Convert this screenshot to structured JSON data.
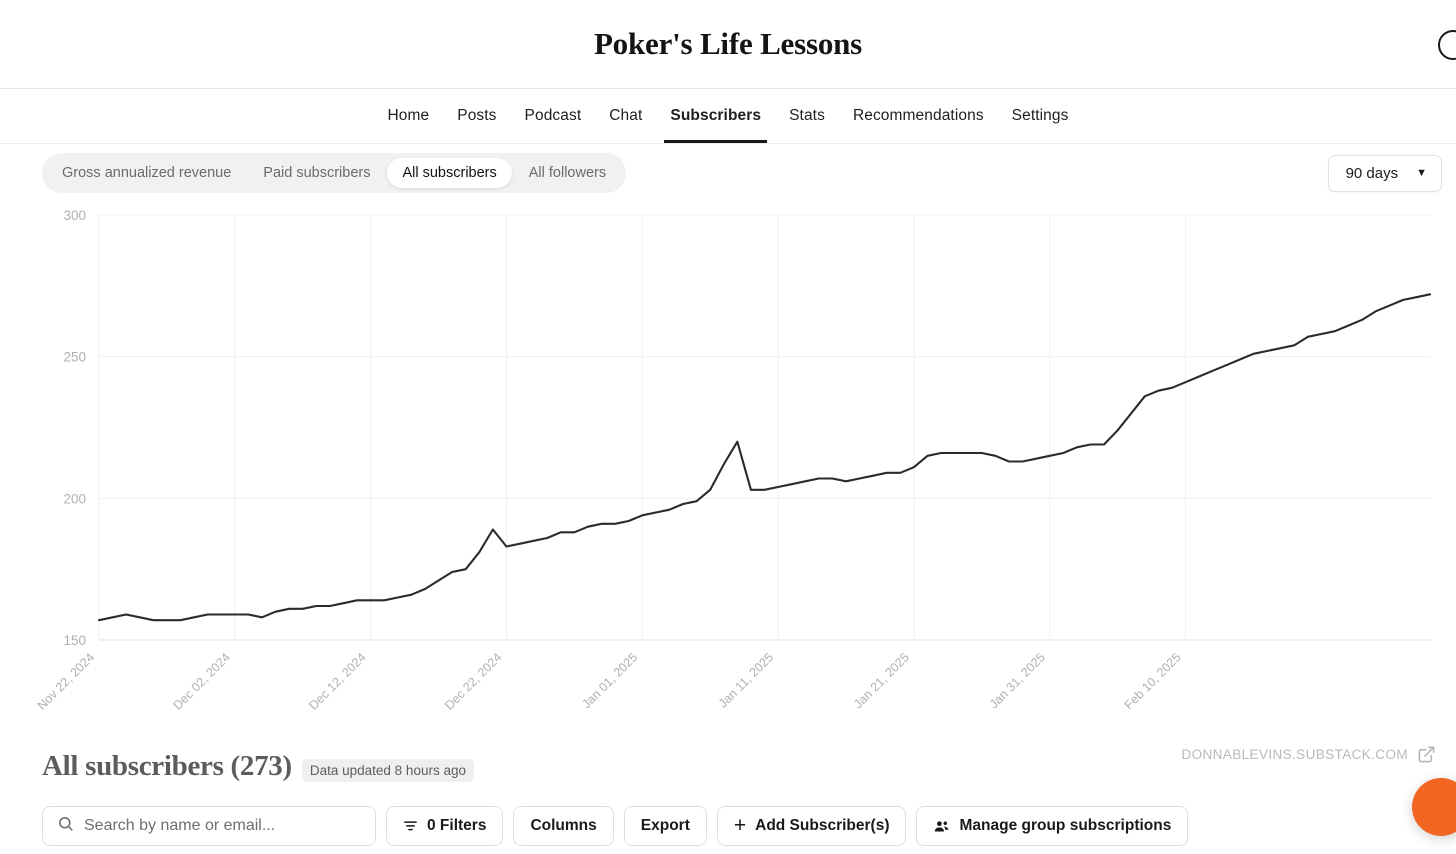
{
  "header": {
    "publication_title": "Poker's Life Lessons",
    "avatar_icon": "profile-circle-icon"
  },
  "nav": {
    "items": [
      {
        "label": "Home",
        "active": false
      },
      {
        "label": "Posts",
        "active": false
      },
      {
        "label": "Podcast",
        "active": false
      },
      {
        "label": "Chat",
        "active": false
      },
      {
        "label": "Subscribers",
        "active": true
      },
      {
        "label": "Stats",
        "active": false
      },
      {
        "label": "Recommendations",
        "active": false
      },
      {
        "label": "Settings",
        "active": false
      }
    ]
  },
  "chart_controls": {
    "pills": [
      {
        "label": "Gross annualized revenue",
        "active": false
      },
      {
        "label": "Paid subscribers",
        "active": false
      },
      {
        "label": "All subscribers",
        "active": true
      },
      {
        "label": "All followers",
        "active": false
      }
    ],
    "range": {
      "label": "90 days",
      "caret_icon": "chevron-down-icon"
    }
  },
  "watermark": {
    "text": "DONNABLEVINS.SUBSTACK.COM",
    "icon": "external-link-icon"
  },
  "list": {
    "title": "All subscribers (273)",
    "data_updated": "Data updated 8 hours ago",
    "search_placeholder": "Search by name or email...",
    "search_value": "",
    "search_icon": "search-icon",
    "buttons": [
      {
        "label": "0 Filters",
        "icon": "filter-funnel-icon"
      },
      {
        "label": "Columns",
        "icon": null
      },
      {
        "label": "Export",
        "icon": null
      },
      {
        "label": "Add Subscriber(s)",
        "icon": "plus-icon"
      },
      {
        "label": "Manage group subscriptions",
        "icon": "people-icon"
      }
    ]
  },
  "fab": {
    "icon": "chat-bubble-icon",
    "color": "#f26522"
  },
  "colors": {
    "line": "#2b2b2b",
    "grid": "#f0f0f0",
    "axis_text": "#b0b0b0",
    "accent": "#f26522"
  },
  "chart_data": {
    "type": "line",
    "title": "",
    "xlabel": "",
    "ylabel": "",
    "ylim": [
      150,
      300
    ],
    "yticks": [
      150,
      200,
      250,
      300
    ],
    "grid": true,
    "legend": null,
    "xticks": [
      "Nov 22, 2024",
      "Dec 02, 2024",
      "Dec 12, 2024",
      "Dec 22, 2024",
      "Jan 01, 2025",
      "Jan 11, 2025",
      "Jan 21, 2025",
      "Jan 31, 2025",
      "Feb 10, 2025"
    ],
    "x_start": "Nov 22, 2024",
    "x_end": "Feb 17, 2025",
    "series": [
      {
        "name": "All subscribers",
        "color": "#2b2b2b",
        "values": [
          157,
          158,
          159,
          158,
          157,
          157,
          157,
          158,
          159,
          159,
          159,
          159,
          158,
          160,
          161,
          161,
          162,
          162,
          163,
          164,
          164,
          164,
          165,
          166,
          168,
          171,
          174,
          175,
          181,
          189,
          183,
          184,
          185,
          186,
          188,
          188,
          190,
          191,
          191,
          192,
          194,
          195,
          196,
          198,
          199,
          203,
          212,
          220,
          203,
          203,
          204,
          205,
          206,
          207,
          207,
          206,
          207,
          208,
          209,
          209,
          211,
          215,
          216,
          216,
          216,
          216,
          215,
          213,
          213,
          214,
          215,
          216,
          218,
          219,
          219,
          224,
          230,
          236,
          238,
          239,
          241,
          243,
          245,
          247,
          249,
          251,
          252,
          253,
          254,
          257,
          258,
          259,
          261,
          263,
          266,
          268,
          270,
          271,
          272
        ]
      }
    ]
  }
}
